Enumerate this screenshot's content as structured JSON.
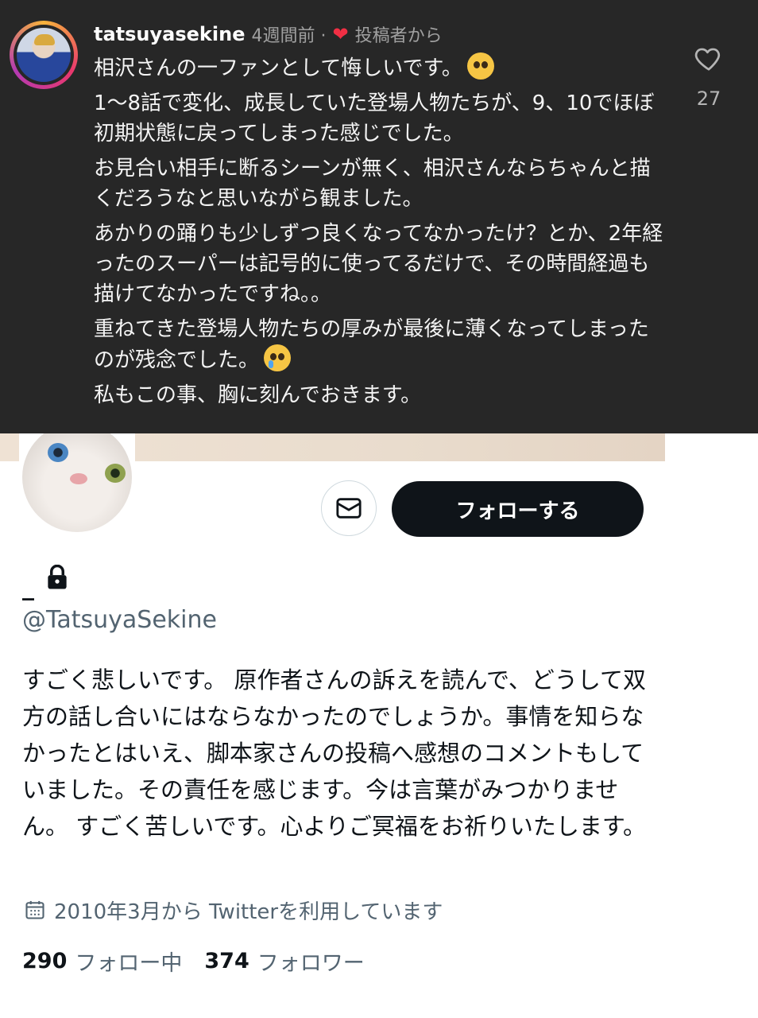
{
  "instagram_comment": {
    "username": "tatsuyasekine",
    "time_ago": "4週間前 ·",
    "author_badge": "投稿者から",
    "paragraphs": [
      "相沢さんの一ファンとして悔しいです。",
      "1〜8話で変化、成長していた登場人物たちが、9、10でほぼ初期状態に戻ってしまった感じでした。",
      "お見合い相手に断るシーンが無く、相沢さんならちゃんと描くだろうなと思いながら観ました。",
      "あかりの踊りも少しずつ良くなってなかったけ？とか、2年経ったのスーパーは記号的に使ってるだけで、その時間経過も描けてなかったですね。。",
      "重ねてきた登場人物たちの厚みが最後に薄くなってしまったのが残念でした。",
      "私もこの事、胸に刻んでおきます。"
    ],
    "emoji_1": "pleading-face",
    "emoji_2": "crying-face",
    "like_count": "27",
    "colors": {
      "background": "#272727",
      "heart": "#f12f44"
    }
  },
  "twitter_profile": {
    "display_name": "_",
    "handle": "@TatsuyaSekine",
    "follow_button_label": "フォローする",
    "bio": "すごく悲しいです。 原作者さんの訴えを読んで、どうして双方の話し合いにはならなかったのでしょうか。事情を知らなかったとはいえ、脚本家さんの投稿へ感想のコメントもしていました。その責任を感じます。今は言葉がみつかりません。 すごく苦しいです。心よりご冥福をお祈りいたします。",
    "joined": "2010年3月から Twitterを利用しています",
    "following_count": "290",
    "following_label": "フォロー中",
    "followers_count": "374",
    "followers_label": "フォロワー",
    "icons": [
      "message-icon",
      "lock-icon",
      "calendar-icon"
    ],
    "colors": {
      "button": "#0f1419",
      "secondary_text": "#536471"
    }
  }
}
